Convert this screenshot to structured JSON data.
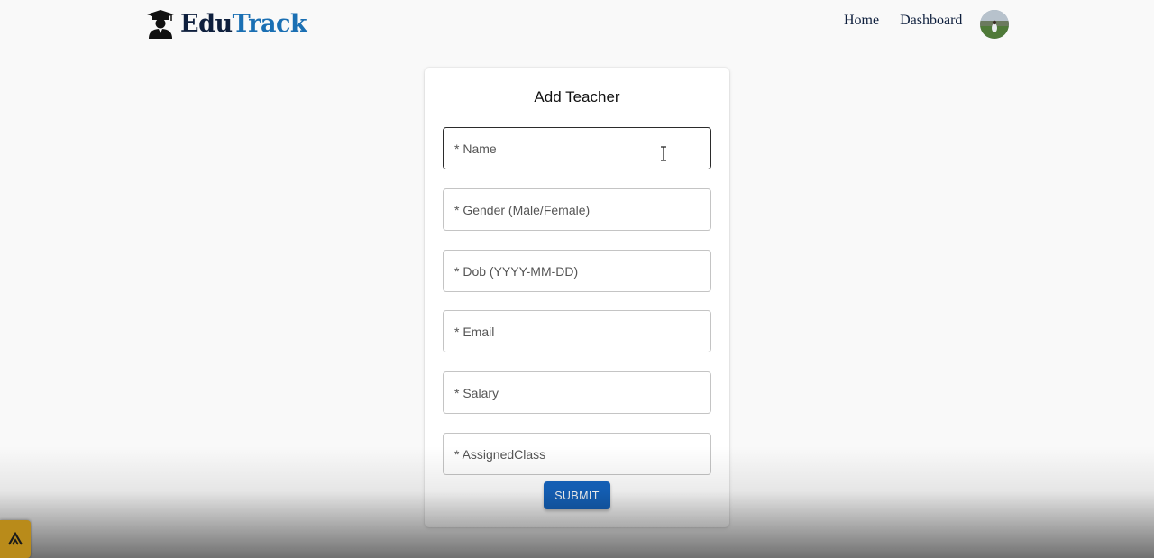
{
  "header": {
    "brand_part1": "Edu",
    "brand_part2": "Track",
    "logo_icon": "graduate-cap-icon",
    "nav": {
      "home": "Home",
      "dashboard": "Dashboard"
    },
    "avatar_icon": "user-avatar"
  },
  "form": {
    "title": "Add Teacher",
    "fields": [
      {
        "placeholder": "* Name",
        "value": ""
      },
      {
        "placeholder": "* Gender (Male/Female)",
        "value": ""
      },
      {
        "placeholder": "* Dob (YYYY-MM-DD)",
        "value": ""
      },
      {
        "placeholder": "* Email",
        "value": ""
      },
      {
        "placeholder": "* Salary",
        "value": ""
      },
      {
        "placeholder": "* AssignedClass",
        "value": ""
      }
    ],
    "submit_label": "SUBMIT"
  },
  "colors": {
    "brand_dark": "#0e1f3d",
    "brand_blue": "#1a6fb3",
    "primary_button": "#1565c0",
    "corner_app": "#b98b1a"
  },
  "corner_app_icon": "app-launcher-icon"
}
